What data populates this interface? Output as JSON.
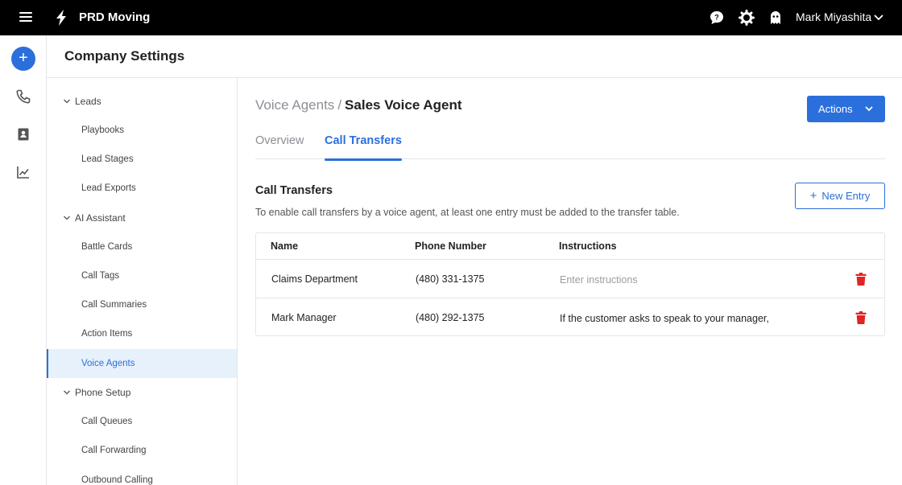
{
  "topbar": {
    "app_title": "PRD Moving",
    "user_name": "Mark Miyashita",
    "icons": [
      "menu-icon",
      "bolt-logo-icon",
      "chat-help-icon",
      "gear-icon",
      "ghost-icon",
      "chevron-down-icon"
    ]
  },
  "rail": {
    "plus_label": "+",
    "icons": [
      "phone-icon",
      "contact-book-icon",
      "chart-icon"
    ]
  },
  "page": {
    "title": "Company Settings"
  },
  "nav": {
    "groups": [
      {
        "label": "Leads",
        "items": [
          "Playbooks",
          "Lead Stages",
          "Lead Exports"
        ]
      },
      {
        "label": "AI Assistant",
        "items": [
          "Battle Cards",
          "Call Tags",
          "Call Summaries",
          "Action Items",
          "Voice Agents"
        ]
      },
      {
        "label": "Phone Setup",
        "items": [
          "Call Queues",
          "Call Forwarding",
          "Outbound Calling"
        ]
      }
    ],
    "active_item": "Voice Agents"
  },
  "main": {
    "breadcrumb": {
      "parent": "Voice Agents",
      "separator": "/",
      "current": "Sales Voice Agent"
    },
    "actions_label": "Actions",
    "tabs": [
      {
        "label": "Overview",
        "active": false
      },
      {
        "label": "Call Transfers",
        "active": true
      }
    ],
    "section": {
      "title": "Call Transfers",
      "description": "To enable call transfers by a voice agent, at least one entry must be added to the transfer table.",
      "new_entry_label": "New Entry"
    },
    "table": {
      "columns": [
        "Name",
        "Phone Number",
        "Instructions"
      ],
      "rows": [
        {
          "name": "Claims Department",
          "phone": "(480) 331-1375",
          "instructions": "",
          "instructions_placeholder": "Enter instructions"
        },
        {
          "name": "Mark Manager",
          "phone": "(480) 292-1375",
          "instructions": "If the customer asks to speak to your manager,",
          "instructions_placeholder": "Enter instructions"
        }
      ]
    }
  },
  "colors": {
    "accent": "#2b6fdc",
    "danger": "#e02424",
    "topbar": "#000000",
    "active_nav_bg": "#e6f1fc"
  }
}
